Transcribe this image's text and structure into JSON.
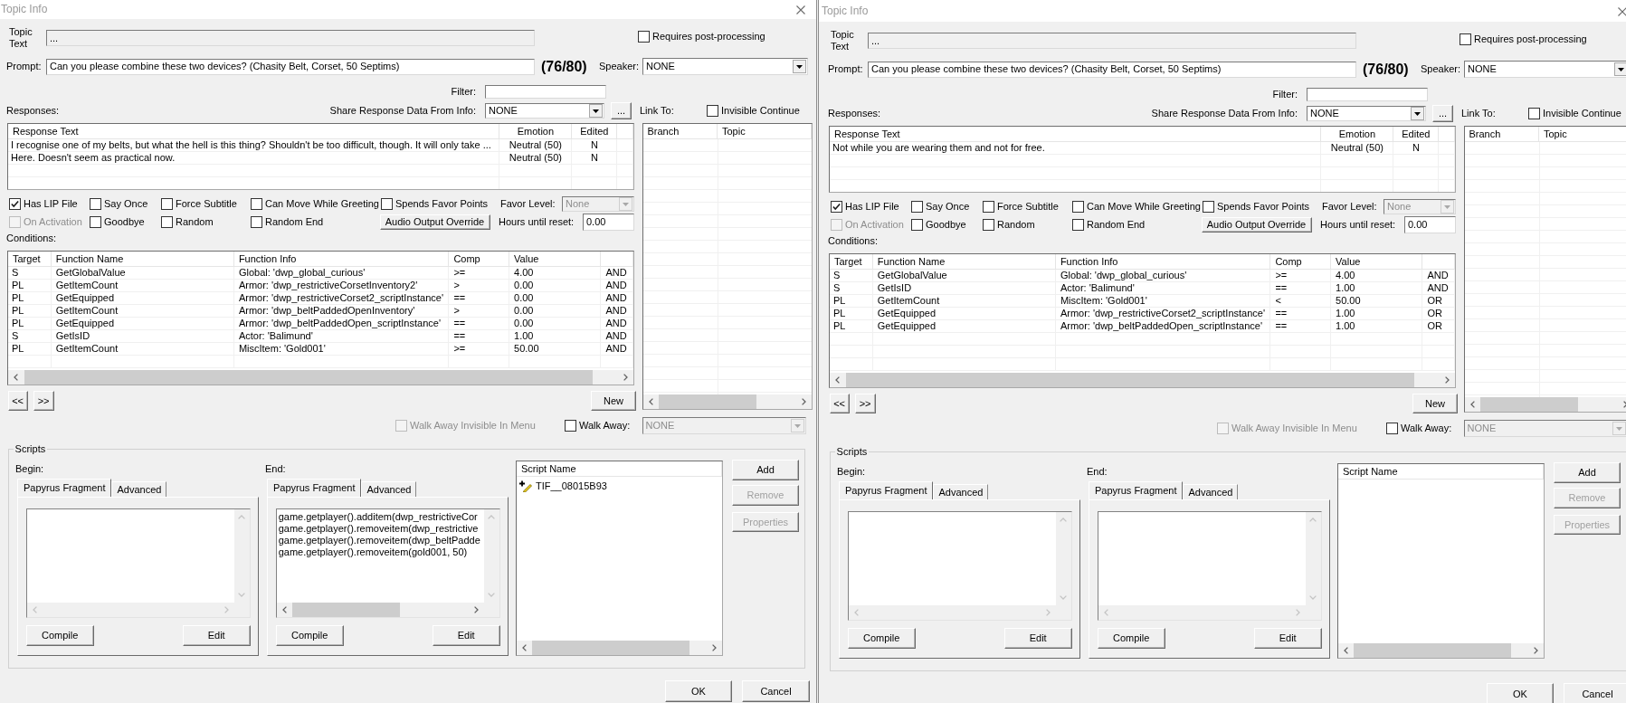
{
  "windows": [
    {
      "title": "Topic Info",
      "topic_text": {
        "label": "Topic Text",
        "value": "...",
        "disabled": true
      },
      "requires_post_processing": {
        "label": "Requires post-processing",
        "checked": false
      },
      "prompt": {
        "label": "Prompt:",
        "value": "Can you please combine these two devices? (Chasity Belt, Corset, 50 Septims)",
        "count": "(76/80)"
      },
      "speaker": {
        "label": "Speaker:",
        "value": "NONE"
      },
      "filter": {
        "label": "Filter:"
      },
      "responses": {
        "label": "Responses:",
        "columns": [
          "Response Text",
          "Emotion",
          "Edited"
        ],
        "rows": [
          [
            "I recognise one of my belts, but what the hell is this thing? Shouldn't be too difficult, though. It will only take ...",
            "Neutral (50)",
            "N"
          ],
          [
            "Here. Doesn't seem as practical now.",
            "Neutral (50)",
            "N"
          ]
        ]
      },
      "share_response_data": {
        "label": "Share Response Data From Info:",
        "value": "NONE",
        "button": "..."
      },
      "link_to": {
        "label": "Link To:",
        "invisible_continue": {
          "label": "Invisible Continue",
          "checked": false
        },
        "columns": [
          "Branch",
          "Topic"
        ]
      },
      "options": [
        [
          {
            "kind": "checkbox",
            "label": "Has LIP File",
            "checked": true,
            "disabled": false
          },
          {
            "kind": "checkbox",
            "label": "Say Once",
            "checked": false,
            "disabled": false
          },
          {
            "kind": "checkbox",
            "label": "Force Subtitle",
            "checked": false,
            "disabled": false
          },
          {
            "kind": "checkbox",
            "label": "Can Move While Greeting",
            "checked": false,
            "disabled": false
          },
          {
            "kind": "checkbox",
            "label": "Spends Favor Points",
            "checked": false,
            "disabled": false
          },
          {
            "kind": "dropdown",
            "label": "Favor Level:",
            "value": "None",
            "disabled": true
          }
        ],
        [
          {
            "kind": "checkbox",
            "label": "On Activation",
            "checked": false,
            "disabled": true
          },
          {
            "kind": "checkbox",
            "label": "Goodbye",
            "checked": false,
            "disabled": false
          },
          {
            "kind": "checkbox",
            "label": "Random",
            "checked": false,
            "disabled": false
          },
          {
            "kind": "checkbox",
            "label": "Random End",
            "checked": false,
            "disabled": false
          },
          {
            "kind": "button",
            "label": "Audio Output Override"
          },
          {
            "kind": "field",
            "label": "Hours until reset:",
            "value": "0.00"
          }
        ]
      ],
      "conditions": {
        "label": "Conditions:",
        "columns": [
          "Target",
          "Function Name",
          "Function Info",
          "Comp",
          "Value"
        ],
        "rows": [
          [
            "S",
            "GetGlobalValue",
            "Global: 'dwp_global_curious'",
            ">=",
            "4.00",
            "AND"
          ],
          [
            "PL",
            "GetItemCount",
            "Armor: 'dwp_restrictiveCorsetInventory2'",
            ">",
            "0.00",
            "AND"
          ],
          [
            "PL",
            "GetEquipped",
            "Armor: 'dwp_restrictiveCorset2_scriptInstance'",
            "==",
            "0.00",
            "AND"
          ],
          [
            "PL",
            "GetItemCount",
            "Armor: 'dwp_beltPaddedOpenInventory'",
            ">",
            "0.00",
            "AND"
          ],
          [
            "PL",
            "GetEquipped",
            "Armor: 'dwp_beltPaddedOpen_scriptInstance'",
            "==",
            "0.00",
            "AND"
          ],
          [
            "S",
            "GetIsID",
            "Actor: 'Balimund'",
            "==",
            "1.00",
            "AND"
          ],
          [
            "PL",
            "GetItemCount",
            "MiscItem: 'Gold001'",
            ">=",
            "50.00",
            "AND"
          ]
        ]
      },
      "condition_buttons": {
        "previous": "<<",
        "next": ">>",
        "new": "New"
      },
      "walk_away": {
        "invisible_in_menu": {
          "label": "Walk Away Invisible In Menu",
          "checked": false,
          "disabled": true
        },
        "walk_away": {
          "label": "Walk Away:",
          "checked": false,
          "disabled": false
        },
        "dropdown": {
          "value": "NONE",
          "disabled": true
        }
      },
      "scripts": {
        "label": "Scripts",
        "fragments": [
          {
            "label": "Begin:",
            "tabs": [
              {
                "label": "Papyrus Fragment",
                "selected": true
              },
              {
                "label": "Advanced",
                "selected": false
              }
            ],
            "buttons": [
              "Compile",
              "Edit"
            ]
          },
          {
            "label": "End:",
            "tabs": [
              {
                "label": "Papyrus Fragment",
                "selected": true
              },
              {
                "label": "Advanced",
                "selected": false
              }
            ],
            "code": [
              "game.getplayer().additem(dwp_restrictiveCor",
              "game.getplayer().removeitem(dwp_restrictive",
              "game.getplayer().removeitem(dwp_beltPadde",
              "game.getplayer().removeitem(gold001, 50)"
            ],
            "buttons": [
              "Compile",
              "Edit"
            ]
          }
        ],
        "script_list": {
          "column": "Script Name",
          "items": [
            "TIF__08015B93"
          ]
        },
        "buttons": [
          {
            "label": "Add",
            "disabled": false
          },
          {
            "label": "Remove",
            "disabled": true
          },
          {
            "label": "Properties",
            "disabled": true
          }
        ]
      },
      "dialog_buttons": [
        "OK",
        "Cancel"
      ]
    },
    {
      "title": "Topic Info",
      "topic_text": {
        "label": "Topic Text",
        "value": "...",
        "disabled": true
      },
      "requires_post_processing": {
        "label": "Requires post-processing",
        "checked": false
      },
      "prompt": {
        "label": "Prompt:",
        "value": "Can you please combine these two devices? (Chasity Belt, Corset, 50 Septims)",
        "count": "(76/80)"
      },
      "speaker": {
        "label": "Speaker:",
        "value": "NONE"
      },
      "filter": {
        "label": "Filter:"
      },
      "responses": {
        "label": "Responses:",
        "columns": [
          "Response Text",
          "Emotion",
          "Edited"
        ],
        "rows": [
          [
            "Not while you are wearing them and not for free.",
            "Neutral (50)",
            "N"
          ]
        ]
      },
      "share_response_data": {
        "label": "Share Response Data From Info:",
        "value": "NONE",
        "button": "..."
      },
      "link_to": {
        "label": "Link To:",
        "invisible_continue": {
          "label": "Invisible Continue",
          "checked": false
        },
        "columns": [
          "Branch",
          "Topic"
        ]
      },
      "options": [
        [
          {
            "kind": "checkbox",
            "label": "Has LIP File",
            "checked": true,
            "disabled": false
          },
          {
            "kind": "checkbox",
            "label": "Say Once",
            "checked": false,
            "disabled": false
          },
          {
            "kind": "checkbox",
            "label": "Force Subtitle",
            "checked": false,
            "disabled": false
          },
          {
            "kind": "checkbox",
            "label": "Can Move While Greeting",
            "checked": false,
            "disabled": false
          },
          {
            "kind": "checkbox",
            "label": "Spends Favor Points",
            "checked": false,
            "disabled": false
          },
          {
            "kind": "dropdown",
            "label": "Favor Level:",
            "value": "None",
            "disabled": true
          }
        ],
        [
          {
            "kind": "checkbox",
            "label": "On Activation",
            "checked": false,
            "disabled": true
          },
          {
            "kind": "checkbox",
            "label": "Goodbye",
            "checked": false,
            "disabled": false
          },
          {
            "kind": "checkbox",
            "label": "Random",
            "checked": false,
            "disabled": false
          },
          {
            "kind": "checkbox",
            "label": "Random End",
            "checked": false,
            "disabled": false
          },
          {
            "kind": "button",
            "label": "Audio Output Override"
          },
          {
            "kind": "field",
            "label": "Hours until reset:",
            "value": "0.00"
          }
        ]
      ],
      "conditions": {
        "label": "Conditions:",
        "columns": [
          "Target",
          "Function Name",
          "Function Info",
          "Comp",
          "Value"
        ],
        "rows": [
          [
            "S",
            "GetGlobalValue",
            "Global: 'dwp_global_curious'",
            ">=",
            "4.00",
            "AND"
          ],
          [
            "S",
            "GetIsID",
            "Actor: 'Balimund'",
            "==",
            "1.00",
            "AND"
          ],
          [
            "PL",
            "GetItemCount",
            "MiscItem: 'Gold001'",
            "<",
            "50.00",
            "OR"
          ],
          [
            "PL",
            "GetEquipped",
            "Armor: 'dwp_restrictiveCorset2_scriptInstance'",
            "==",
            "1.00",
            "OR"
          ],
          [
            "PL",
            "GetEquipped",
            "Armor: 'dwp_beltPaddedOpen_scriptInstance'",
            "==",
            "1.00",
            "OR"
          ]
        ]
      },
      "condition_buttons": {
        "previous": "<<",
        "next": ">>",
        "new": "New"
      },
      "walk_away": {
        "invisible_in_menu": {
          "label": "Walk Away Invisible In Menu",
          "checked": false,
          "disabled": true
        },
        "walk_away": {
          "label": "Walk Away:",
          "checked": false,
          "disabled": false
        },
        "dropdown": {
          "value": "NONE",
          "disabled": true
        }
      },
      "scripts": {
        "label": "Scripts",
        "fragments": [
          {
            "label": "Begin:",
            "tabs": [
              {
                "label": "Papyrus Fragment",
                "selected": true
              },
              {
                "label": "Advanced",
                "selected": false
              }
            ],
            "buttons": [
              "Compile",
              "Edit"
            ]
          },
          {
            "label": "End:",
            "tabs": [
              {
                "label": "Papyrus Fragment",
                "selected": true
              },
              {
                "label": "Advanced",
                "selected": false
              }
            ],
            "buttons": [
              "Compile",
              "Edit"
            ]
          }
        ],
        "script_list": {
          "column": "Script Name"
        },
        "buttons": [
          {
            "label": "Add",
            "disabled": false
          },
          {
            "label": "Remove",
            "disabled": true
          },
          {
            "label": "Properties",
            "disabled": true
          }
        ]
      },
      "dialog_buttons": [
        "OK",
        "Cancel"
      ]
    }
  ]
}
